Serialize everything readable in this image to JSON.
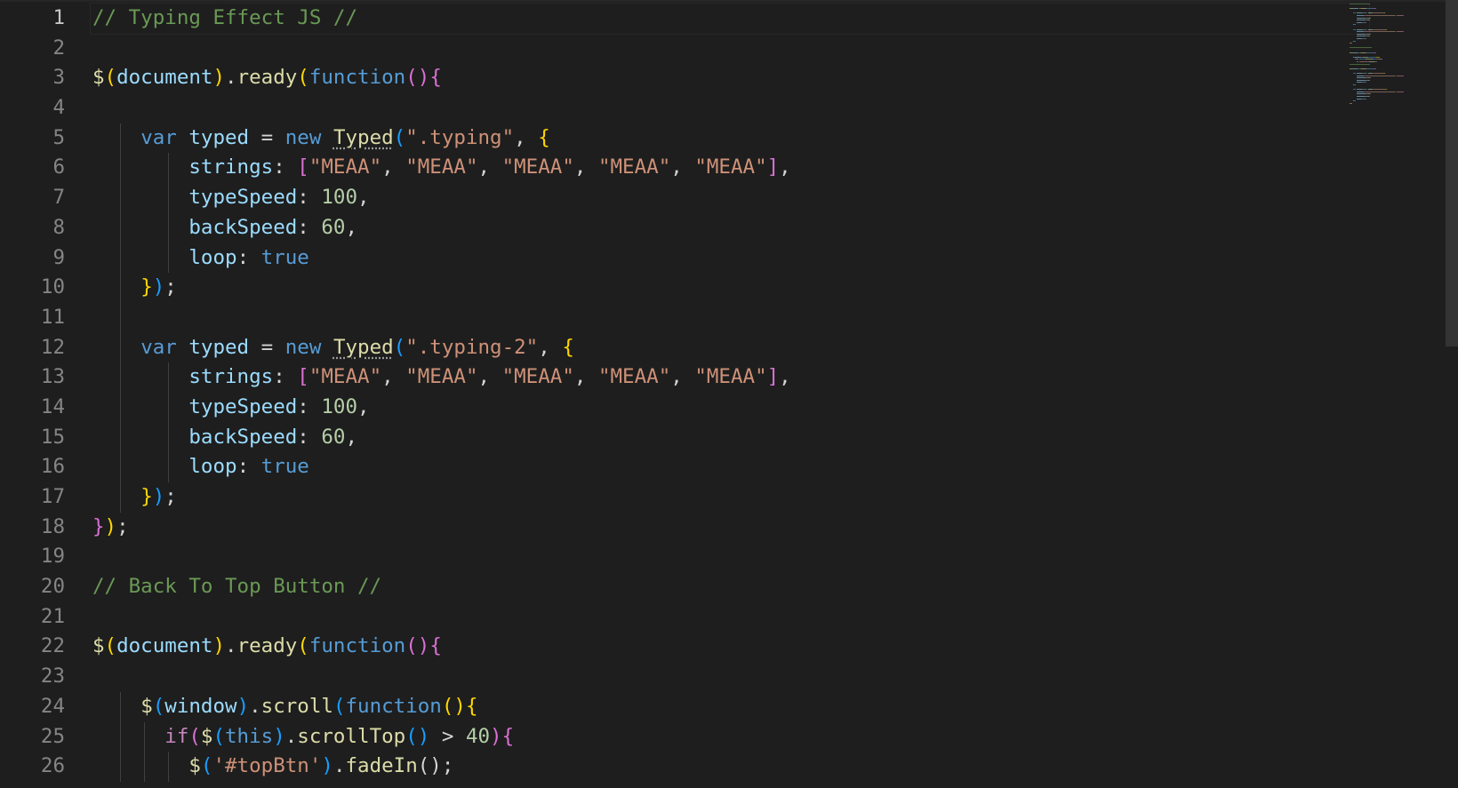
{
  "editor": {
    "active_line": 1,
    "colors": {
      "background": "#1e1e1e",
      "comment": "#6a9955",
      "keyword": "#569cd6",
      "string": "#ce9178",
      "number": "#b5cea8",
      "function": "#dcdcaa",
      "variable": "#9cdcfe",
      "control": "#c586c0"
    },
    "lines": [
      {
        "n": "1",
        "tokens": [
          [
            "// Typing Effect JS //",
            "comment"
          ]
        ]
      },
      {
        "n": "2",
        "tokens": []
      },
      {
        "n": "3",
        "tokens": [
          [
            "$",
            "func"
          ],
          [
            "(",
            "br1"
          ],
          [
            "document",
            "var"
          ],
          [
            ")",
            "br1"
          ],
          [
            ".",
            "p"
          ],
          [
            "ready",
            "func"
          ],
          [
            "(",
            "br1"
          ],
          [
            "function",
            "key"
          ],
          [
            "()",
            "br2"
          ],
          [
            "{",
            "br2"
          ]
        ]
      },
      {
        "n": "4",
        "tokens": []
      },
      {
        "n": "5",
        "tokens": [
          [
            "    ",
            "p"
          ],
          [
            "var",
            "key"
          ],
          [
            " ",
            "p"
          ],
          [
            "typed",
            "var"
          ],
          [
            " = ",
            "p"
          ],
          [
            "new",
            "key"
          ],
          [
            " ",
            "p"
          ],
          [
            "Typed",
            "cls"
          ],
          [
            "(",
            "br3"
          ],
          [
            "\".typing\"",
            "str"
          ],
          [
            ", ",
            "p"
          ],
          [
            "{",
            "br1"
          ]
        ]
      },
      {
        "n": "6",
        "tokens": [
          [
            "        ",
            "p"
          ],
          [
            "strings",
            "var"
          ],
          [
            ": ",
            "p"
          ],
          [
            "[",
            "br2"
          ],
          [
            "\"MEAA\"",
            "str"
          ],
          [
            ", ",
            "p"
          ],
          [
            "\"MEAA\"",
            "str"
          ],
          [
            ", ",
            "p"
          ],
          [
            "\"MEAA\"",
            "str"
          ],
          [
            ", ",
            "p"
          ],
          [
            "\"MEAA\"",
            "str"
          ],
          [
            ", ",
            "p"
          ],
          [
            "\"MEAA\"",
            "str"
          ],
          [
            "]",
            "br2"
          ],
          [
            ",",
            "p"
          ]
        ]
      },
      {
        "n": "7",
        "tokens": [
          [
            "        ",
            "p"
          ],
          [
            "typeSpeed",
            "var"
          ],
          [
            ": ",
            "p"
          ],
          [
            "100",
            "num"
          ],
          [
            ",",
            "p"
          ]
        ]
      },
      {
        "n": "8",
        "tokens": [
          [
            "        ",
            "p"
          ],
          [
            "backSpeed",
            "var"
          ],
          [
            ": ",
            "p"
          ],
          [
            "60",
            "num"
          ],
          [
            ",",
            "p"
          ]
        ]
      },
      {
        "n": "9",
        "tokens": [
          [
            "        ",
            "p"
          ],
          [
            "loop",
            "var"
          ],
          [
            ": ",
            "p"
          ],
          [
            "true",
            "key"
          ]
        ]
      },
      {
        "n": "10",
        "tokens": [
          [
            "    ",
            "p"
          ],
          [
            "}",
            "br1"
          ],
          [
            ")",
            "br3"
          ],
          [
            ";",
            "p"
          ]
        ]
      },
      {
        "n": "11",
        "tokens": []
      },
      {
        "n": "12",
        "tokens": [
          [
            "    ",
            "p"
          ],
          [
            "var",
            "key"
          ],
          [
            " ",
            "p"
          ],
          [
            "typed",
            "var"
          ],
          [
            " = ",
            "p"
          ],
          [
            "new",
            "key"
          ],
          [
            " ",
            "p"
          ],
          [
            "Typed",
            "cls"
          ],
          [
            "(",
            "br3"
          ],
          [
            "\".typing-2\"",
            "str"
          ],
          [
            ", ",
            "p"
          ],
          [
            "{",
            "br1"
          ]
        ]
      },
      {
        "n": "13",
        "tokens": [
          [
            "        ",
            "p"
          ],
          [
            "strings",
            "var"
          ],
          [
            ": ",
            "p"
          ],
          [
            "[",
            "br2"
          ],
          [
            "\"MEAA\"",
            "str"
          ],
          [
            ", ",
            "p"
          ],
          [
            "\"MEAA\"",
            "str"
          ],
          [
            ", ",
            "p"
          ],
          [
            "\"MEAA\"",
            "str"
          ],
          [
            ", ",
            "p"
          ],
          [
            "\"MEAA\"",
            "str"
          ],
          [
            ", ",
            "p"
          ],
          [
            "\"MEAA\"",
            "str"
          ],
          [
            "]",
            "br2"
          ],
          [
            ",",
            "p"
          ]
        ]
      },
      {
        "n": "14",
        "tokens": [
          [
            "        ",
            "p"
          ],
          [
            "typeSpeed",
            "var"
          ],
          [
            ": ",
            "p"
          ],
          [
            "100",
            "num"
          ],
          [
            ",",
            "p"
          ]
        ]
      },
      {
        "n": "15",
        "tokens": [
          [
            "        ",
            "p"
          ],
          [
            "backSpeed",
            "var"
          ],
          [
            ": ",
            "p"
          ],
          [
            "60",
            "num"
          ],
          [
            ",",
            "p"
          ]
        ]
      },
      {
        "n": "16",
        "tokens": [
          [
            "        ",
            "p"
          ],
          [
            "loop",
            "var"
          ],
          [
            ": ",
            "p"
          ],
          [
            "true",
            "key"
          ]
        ]
      },
      {
        "n": "17",
        "tokens": [
          [
            "    ",
            "p"
          ],
          [
            "}",
            "br1"
          ],
          [
            ")",
            "br3"
          ],
          [
            ";",
            "p"
          ]
        ]
      },
      {
        "n": "18",
        "tokens": [
          [
            "}",
            "br2"
          ],
          [
            ")",
            "br1"
          ],
          [
            ";",
            "p"
          ]
        ]
      },
      {
        "n": "19",
        "tokens": []
      },
      {
        "n": "20",
        "tokens": [
          [
            "// Back To Top Button //",
            "comment"
          ]
        ]
      },
      {
        "n": "21",
        "tokens": []
      },
      {
        "n": "22",
        "tokens": [
          [
            "$",
            "func"
          ],
          [
            "(",
            "br1"
          ],
          [
            "document",
            "var"
          ],
          [
            ")",
            "br1"
          ],
          [
            ".",
            "p"
          ],
          [
            "ready",
            "func"
          ],
          [
            "(",
            "br1"
          ],
          [
            "function",
            "key"
          ],
          [
            "()",
            "br2"
          ],
          [
            "{",
            "br2"
          ]
        ]
      },
      {
        "n": "23",
        "tokens": []
      },
      {
        "n": "24",
        "tokens": [
          [
            "    ",
            "p"
          ],
          [
            "$",
            "func"
          ],
          [
            "(",
            "br3"
          ],
          [
            "window",
            "var"
          ],
          [
            ")",
            "br3"
          ],
          [
            ".",
            "p"
          ],
          [
            "scroll",
            "func"
          ],
          [
            "(",
            "br3"
          ],
          [
            "function",
            "key"
          ],
          [
            "()",
            "br1"
          ],
          [
            "{",
            "br1"
          ]
        ]
      },
      {
        "n": "25",
        "tokens": [
          [
            "      ",
            "p"
          ],
          [
            "if",
            "ctl"
          ],
          [
            "(",
            "br2"
          ],
          [
            "$",
            "func"
          ],
          [
            "(",
            "br3"
          ],
          [
            "this",
            "key"
          ],
          [
            ")",
            "br3"
          ],
          [
            ".",
            "p"
          ],
          [
            "scrollTop",
            "func"
          ],
          [
            "()",
            "br3"
          ],
          [
            " > ",
            "p"
          ],
          [
            "40",
            "num"
          ],
          [
            ")",
            "br2"
          ],
          [
            "{",
            "br2"
          ]
        ]
      },
      {
        "n": "26",
        "tokens": [
          [
            "        ",
            "p"
          ],
          [
            "$",
            "func"
          ],
          [
            "(",
            "br3"
          ],
          [
            "'#topBtn'",
            "str"
          ],
          [
            ")",
            "br3"
          ],
          [
            ".",
            "p"
          ],
          [
            "fadeIn",
            "func"
          ],
          [
            "();",
            "p"
          ]
        ]
      }
    ],
    "guides": [
      {
        "from": 5,
        "to": 17,
        "col": 0
      },
      {
        "from": 6,
        "to": 9,
        "col": 4
      },
      {
        "from": 13,
        "to": 16,
        "col": 4
      },
      {
        "from": 24,
        "to": 26,
        "col": 0
      },
      {
        "from": 25,
        "to": 26,
        "col": 2
      },
      {
        "from": 26,
        "to": 26,
        "col": 4
      }
    ]
  }
}
